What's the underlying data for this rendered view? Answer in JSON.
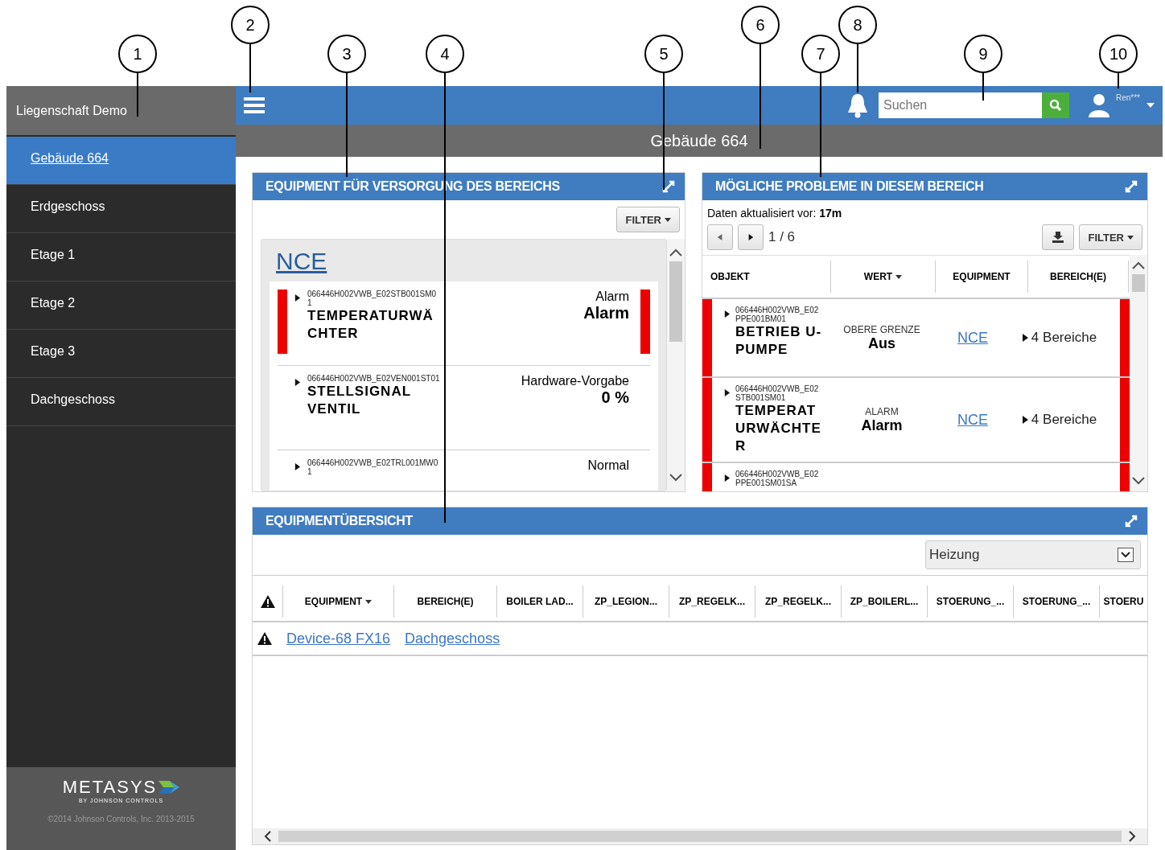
{
  "callouts": [
    "1",
    "2",
    "3",
    "4",
    "5",
    "6",
    "7",
    "8",
    "9",
    "10"
  ],
  "sidebar": {
    "title": "Liegenschaft Demo",
    "items": [
      {
        "label": "Gebäude 664",
        "selected": true
      },
      {
        "label": "Erdgeschoss",
        "selected": false
      },
      {
        "label": "Etage 1",
        "selected": false
      },
      {
        "label": "Etage 2",
        "selected": false
      },
      {
        "label": "Etage 3",
        "selected": false
      },
      {
        "label": "Dachgeschoss",
        "selected": false
      }
    ],
    "footer": {
      "logo": "METASYS",
      "logo_sub": "BY JOHNSON CONTROLS",
      "copyright": "©2014 Johnson Controls, Inc. 2013-2015"
    }
  },
  "topbar": {
    "search": {
      "placeholder": "Suchen"
    },
    "user": "Ren***"
  },
  "page_title": "Gebäude 664",
  "equipment_panel": {
    "title": "EQUIPMENT FÜR VERSORGUNG DES BEREICHS",
    "filter": "FILTER",
    "group": "NCE",
    "items": [
      {
        "id": "066446H002VWB_E02STB001SM01",
        "name": "TEMPERATURWÄCHTER",
        "status": "Alarm",
        "value": "Alarm",
        "alarm": true
      },
      {
        "id": "066446H002VWB_E02VEN001ST01",
        "name": "STELLSIGNAL VENTIL",
        "status": "Hardware-Vorgabe",
        "value": "0 %",
        "alarm": false
      },
      {
        "id": "066446H002VWB_E02TRL001MW01",
        "status": "Normal",
        "alarm": false
      }
    ]
  },
  "problems_panel": {
    "title": "MÖGLICHE PROBLEME IN DIESEM BEREICH",
    "updated": "Daten aktualisiert vor: **17m**",
    "pager": "1 / 6",
    "filter": "FILTER",
    "columns": [
      {
        "label": "OBJEKT",
        "sorted": false
      },
      {
        "label": "WERT",
        "sorted": true
      },
      {
        "label": "EQUIPMENT",
        "sorted": false
      },
      {
        "label": "BEREICH(E)",
        "sorted": false
      }
    ],
    "rows": [
      {
        "id": "066446H002VWB_E02 PPE001BM01",
        "name": "BETRIEB U-PUMPE",
        "value_label": "OBERE GRENZE",
        "value": "Aus",
        "equipment": "NCE",
        "areas": "4 Bereiche",
        "alarm": true
      },
      {
        "id": "066446H002VWB_E02 STB001SM01",
        "name": "TEMPERATURWÄCHTER",
        "value_label": "ALARM",
        "value": "Alarm",
        "equipment": "NCE",
        "areas": "4 Bereiche",
        "alarm": true
      },
      {
        "id": "066446H002VWB_E02 PPE001SM01SA",
        "alarm": true
      }
    ]
  },
  "overview_panel": {
    "title": "EQUIPMENTÜBERSICHT",
    "select": "Heizung",
    "columns": [
      {
        "label": "EQUIPMENT",
        "sorted": true
      },
      {
        "label": "BEREICH(E)",
        "sorted": false
      },
      {
        "label": "BOILER LAD...",
        "sorted": false
      },
      {
        "label": "ZP_LEGION...",
        "sorted": false
      },
      {
        "label": "ZP_REGELK...",
        "sorted": false
      },
      {
        "label": "ZP_REGELK...",
        "sorted": false
      },
      {
        "label": "ZP_BOILERL...",
        "sorted": false
      },
      {
        "label": "STOERUNG_...",
        "sorted": false
      },
      {
        "label": "STOERUNG_...",
        "sorted": false
      },
      {
        "label": "STOERU",
        "sorted": false
      }
    ],
    "rows": [
      {
        "equipment": "Device-68 FX16",
        "area": "Dachgeschoss"
      }
    ]
  }
}
